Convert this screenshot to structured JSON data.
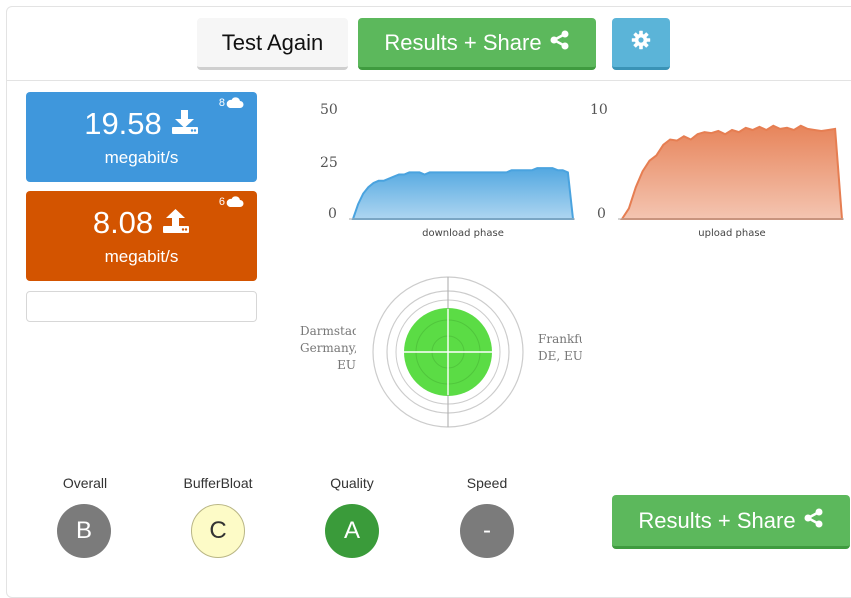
{
  "toolbar": {
    "test_again_label": "Test Again",
    "results_share_label": "Results + Share",
    "settings_icon": "gear-icon",
    "share_icon": "share-icon"
  },
  "download": {
    "value": "19.58",
    "unit": "megabit/s",
    "servers": "8",
    "icon": "download-icon",
    "color": "#3f97dc"
  },
  "upload": {
    "value": "8.08",
    "unit": "megabit/s",
    "servers": "6",
    "icon": "upload-icon",
    "color": "#d35400"
  },
  "chart_data": [
    {
      "type": "area",
      "xlabel": "download phase",
      "ylim": [
        0,
        50
      ],
      "yticks": [
        "50",
        "25",
        "0"
      ],
      "color": "#4aa3df",
      "values": [
        0,
        7,
        12,
        15,
        17,
        18,
        18,
        19,
        20,
        21,
        21,
        22,
        22,
        22,
        21,
        22,
        22,
        22,
        22,
        22,
        22,
        22,
        22,
        22,
        22,
        22,
        22,
        22,
        22,
        22,
        22,
        23,
        23,
        23,
        23,
        23,
        24,
        24,
        24,
        24,
        23,
        23,
        22,
        0
      ]
    },
    {
      "type": "area",
      "xlabel": "upload phase",
      "ylim": [
        0,
        10
      ],
      "yticks": [
        "10",
        "0"
      ],
      "color": "#e67e52",
      "values": [
        0,
        1,
        3,
        4.5,
        5.5,
        6,
        7,
        7.5,
        7.4,
        7.8,
        7.5,
        8,
        8.2,
        8.1,
        8.3,
        8.0,
        8.4,
        8.2,
        8.6,
        8.4,
        8.7,
        8.4,
        8.8,
        8.5,
        8.6,
        8.4,
        8.8,
        8.5,
        8.4,
        8.3,
        8.4,
        8.5,
        0
      ]
    }
  ],
  "servers_map": {
    "left": "Darmstadt,\nGermany,\nEU",
    "right": "Frankfurt,\nDE, EU"
  },
  "grades": {
    "overall_label": "Overall",
    "overall": "B",
    "bufferbloat_label": "BufferBloat",
    "bufferbloat": "C",
    "quality_label": "Quality",
    "quality": "A",
    "speed_label": "Speed",
    "speed": "-"
  },
  "share_bottom_label": "Results + Share"
}
